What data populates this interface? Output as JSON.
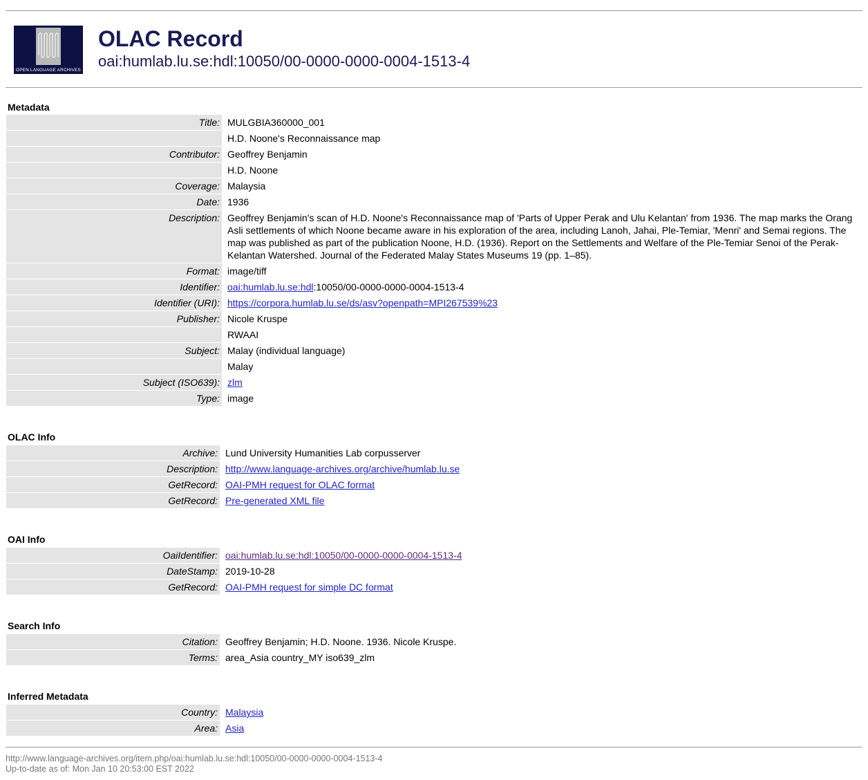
{
  "header": {
    "logo_caption": "OPEN LANGUAGE ARCHIVES",
    "title": "OLAC Record",
    "subtitle": "oai:humlab.lu.se:hdl:10050/00-0000-0000-0004-1513-4"
  },
  "metadata": {
    "section_title": "Metadata",
    "rows": [
      {
        "label": "Title:",
        "value": "MULGBIA360000_001"
      },
      {
        "label": "",
        "value": "H.D. Noone's Reconnaissance map"
      },
      {
        "label": "Contributor:",
        "value": "Geoffrey Benjamin"
      },
      {
        "label": "",
        "value": "H.D. Noone"
      },
      {
        "label": "Coverage:",
        "value": "Malaysia"
      },
      {
        "label": "Date:",
        "value": "1936"
      },
      {
        "label": "Description:",
        "value": "Geoffrey Benjamin's scan of H.D. Noone's Reconnaissance map of 'Parts of Upper Perak and Ulu Kelantan' from 1936. The map marks the Orang Asli settlements of which Noone became aware in his exploration of the area, including Lanoh, Jahai, Ple-Temiar, 'Menri' and Semai regions. The map was published as part of the publication Noone, H.D. (1936). Report on the Settlements and Welfare of the Ple-Temiar Senoi of the Perak-Kelantan Watershed. Journal of the Federated Malay States Museums 19 (pp. 1–85)."
      },
      {
        "label": "Format:",
        "value": "image/tiff"
      },
      {
        "label": "Identifier:",
        "link": "oai:humlab.lu.se:hdl",
        "value": ":10050/00-0000-0000-0004-1513-4"
      },
      {
        "label": "Identifier (URI):",
        "link": "https://corpora.humlab.lu.se/ds/asv?openpath=MPI267539%23"
      },
      {
        "label": "Publisher:",
        "value": "Nicole Kruspe"
      },
      {
        "label": "",
        "value": "RWAAI"
      },
      {
        "label": "Subject:",
        "value": "Malay (individual language)"
      },
      {
        "label": "",
        "value": "Malay"
      },
      {
        "label": "Subject (ISO639):",
        "link": "zlm"
      },
      {
        "label": "Type:",
        "value": "image"
      }
    ]
  },
  "olac_info": {
    "section_title": "OLAC Info",
    "rows": [
      {
        "label": "Archive:",
        "value": "Lund University Humanities Lab corpusserver"
      },
      {
        "label": "Description:",
        "link": "http://www.language-archives.org/archive/humlab.lu.se"
      },
      {
        "label": "GetRecord:",
        "link": "OAI-PMH request for OLAC format"
      },
      {
        "label": "GetRecord:",
        "link": "Pre-generated XML file"
      }
    ]
  },
  "oai_info": {
    "section_title": "OAI Info",
    "rows": [
      {
        "label": "OaiIdentifier:",
        "link": "oai:humlab.lu.se:hdl:10050/00-0000-0000-0004-1513-4"
      },
      {
        "label": "DateStamp:",
        "value": "2019-10-28"
      },
      {
        "label": "GetRecord:",
        "link": "OAI-PMH request for simple DC format"
      }
    ]
  },
  "search_info": {
    "section_title": "Search Info",
    "rows": [
      {
        "label": "Citation:",
        "value": "Geoffrey Benjamin; H.D. Noone. 1936. Nicole Kruspe."
      },
      {
        "label": "Terms:",
        "value": "area_Asia country_MY iso639_zlm"
      }
    ]
  },
  "inferred": {
    "section_title": "Inferred Metadata",
    "rows": [
      {
        "label": "Country:",
        "link": "Malaysia"
      },
      {
        "label": "Area:",
        "link": "Asia"
      }
    ]
  },
  "footer": {
    "url": "http://www.language-archives.org/item.php/oai:humlab.lu.se:hdl:10050/00-0000-0000-0004-1513-4",
    "updated": "Up-to-date as of: Mon Jan 10 20:53:00 EST 2022"
  }
}
